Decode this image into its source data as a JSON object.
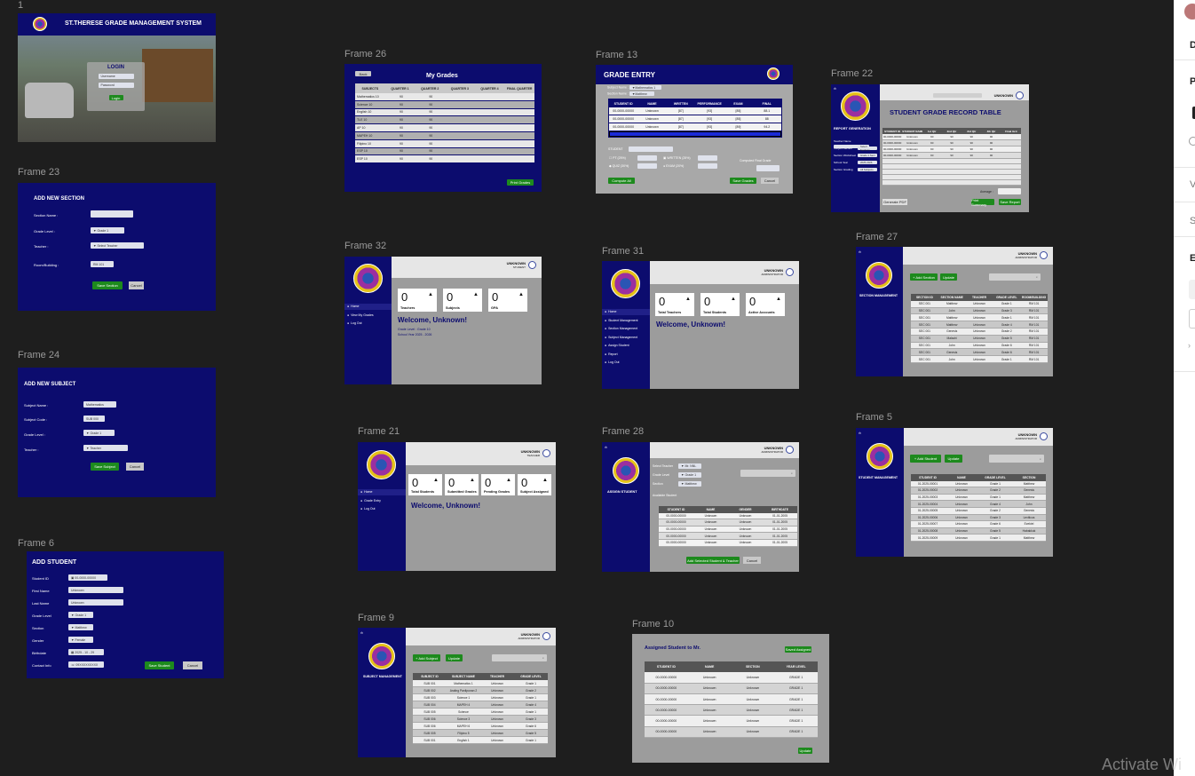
{
  "frames": {
    "f1": {
      "label": "1",
      "title": "ST.THERESE GRADE MANAGEMENT SYSTEM",
      "login": "LOGIN",
      "user_ph": "Username",
      "pass_ph": "Password",
      "login_btn": "Login"
    },
    "f23": {
      "label": "Frame 23",
      "title": "ADD NEW SECTION",
      "fields": [
        "Section Name :",
        "Grade Level :",
        "Teacher :",
        "Room/Building :"
      ],
      "grade": "Grade 1",
      "teacher": "Select Teacher",
      "room": "RM 101",
      "save": "Save Section",
      "cancel": "Cancel"
    },
    "f24": {
      "label": "Frame 24",
      "title": "ADD NEW SUBJECT",
      "fields": [
        "Subject Name :",
        "Subject Code :",
        "Grade Level :",
        "Teacher :"
      ],
      "name": "Mathematics",
      "code": "SUB 000",
      "grade": "Grade 1",
      "teacher": "Teacher",
      "save": "Save Subject",
      "cancel": "Cancel"
    },
    "f6": {
      "label": "Frame 6",
      "title": "ADD STUDENT",
      "fields": [
        "Student ID",
        "First Name",
        "Last Name",
        "Grade Level",
        "Section",
        "Gender",
        "Birthdate",
        "Contact Info"
      ],
      "values": [
        "00-0000-00000",
        "Unknown",
        "Unknown",
        "Grade 1",
        "Matthew",
        "Female",
        "2025 - 10 - 29",
        "09XXXXXXXXX"
      ],
      "save": "Save Student",
      "cancel": "Cancel"
    },
    "f26": {
      "label": "Frame 26",
      "title": "My Grades",
      "back": "Back",
      "headers": [
        "SUBJECTS",
        "QUARTER 1",
        "QUARTER 2",
        "QUARTER 3",
        "QUARTER 4",
        "FINAL QUARTER"
      ],
      "rows": [
        [
          "Mathematics 10",
          "90",
          "90"
        ],
        [
          "Science 10",
          "90",
          "90"
        ],
        [
          "English 10",
          "90",
          "90"
        ],
        [
          "TLE 10",
          "90",
          "90"
        ],
        [
          "AP 10",
          "90",
          "90"
        ],
        [
          "MAPEH 10",
          "90",
          "90"
        ],
        [
          "Filipino 10",
          "90",
          "90"
        ],
        [
          "ESP 10",
          "90",
          "90"
        ],
        [
          "ESP 10",
          "90",
          "90"
        ]
      ],
      "print": "Print Grades"
    },
    "f13": {
      "label": "Frame 13",
      "title": "GRADE ENTRY",
      "subject_lbl": "Subject Name :",
      "subject": "Mathematics 1",
      "section_lbl": "Section Name :",
      "section": "Matthew",
      "headers": [
        "STUDENT ID",
        "NAME",
        "WRITTEN",
        "PERFORMANCE",
        "EXAM",
        "FINAL"
      ],
      "rows": [
        [
          "00-0000-00000",
          "Unknown",
          "[87]",
          "[93]",
          "[85]",
          "88.1"
        ],
        [
          "00-0000-00000",
          "Unknown",
          "[87]",
          "[93]",
          "[85]",
          "88"
        ],
        [
          "00-0000-00000",
          "Unknown",
          "[87]",
          "[93]",
          "[89]",
          "94.2"
        ]
      ],
      "student": "STUDENT",
      "pt": "PT (25%)",
      "wwt": "WRITTEN (25%)",
      "quiz": "QUIZ (30%)",
      "exam": "EXAM (20%)",
      "computed": "Computed Final Grade",
      "compute_all": "Compute All",
      "save": "Save Grades",
      "cancel": "Cancel"
    },
    "f22": {
      "label": "Frame 22",
      "title": "STUDENT GRADE RECORD TABLE",
      "side": "REPORT GENERATION",
      "user": "UNKNOWN",
      "role": "Teacher",
      "fields": [
        "Teacher Name",
        "Subject/Section",
        "Section Worksheet",
        "School Year",
        "Section Grading"
      ],
      "field_vals": [
        "Select Sections",
        "Grade 1 Sect",
        "2025-2026",
        "All Subjects"
      ],
      "headers": [
        "STUDENT ID",
        "STUDENT NAME",
        "1st Qtr",
        "2nd Qtr",
        "3rd Qtr",
        "4th Qtr",
        "Final Grd"
      ],
      "rows": [
        [
          "00-0000-00000",
          "Unknown",
          "90",
          "90",
          "90",
          "90",
          ""
        ],
        [
          "00-0000-00000",
          "Unknown",
          "90",
          "90",
          "90",
          "90",
          ""
        ],
        [
          "00-0000-00000",
          "Unknown",
          "90",
          "90",
          "90",
          "90",
          ""
        ],
        [
          "00-0000-00000",
          "Unknown",
          "90",
          "90",
          "90",
          "90",
          ""
        ]
      ],
      "average": "Average :",
      "gen_pdf": "Generate PDF",
      "print": "Print Summary",
      "save": "Save Report"
    },
    "f32": {
      "label": "Frame 32",
      "user": "UNKNOWN",
      "role": "STUDENT",
      "cards": [
        {
          "n": "0",
          "l": "Teachers"
        },
        {
          "n": "0",
          "l": "Subjects"
        },
        {
          "n": "0",
          "l": "GPA"
        }
      ],
      "welcome": "Welcome, Unknown!",
      "grade": "Grade Level : Grade 10",
      "sy": "School Year 2025 - 2026",
      "nav": [
        "Home",
        "View My Grades",
        "Log Out"
      ]
    },
    "f31": {
      "label": "Frame 31",
      "user": "UNKNOWN",
      "role": "ADMINISTRATOR",
      "cards": [
        {
          "n": "0",
          "l": "Total Teachers"
        },
        {
          "n": "0",
          "l": "Total Students"
        },
        {
          "n": "0",
          "l": "Active Accounts"
        }
      ],
      "welcome": "Welcome, Unknown!",
      "nav": [
        "Home",
        "Student Management",
        "Section Management",
        "Subject Management",
        "Assign Student",
        "Report",
        "Log Out"
      ]
    },
    "f27": {
      "label": "Frame 27",
      "side": "SECTION MANAGEMENT",
      "user": "UNKNOWN",
      "role": "ADMINISTRATOR",
      "add": "+ Add Section",
      "update": "Update",
      "headers": [
        "SECTION ID",
        "SECTION NAME",
        "TEACHER",
        "GRADE LEVEL",
        "ROOM/BUILDING"
      ],
      "rows": [
        [
          "SEC 001",
          "Matthew",
          "Unknown",
          "Grade 1",
          "RM 101"
        ],
        [
          "SEC 001",
          "John",
          "Unknown",
          "Grade 3",
          "RM 101"
        ],
        [
          "SEC 001",
          "Matthew",
          "Unknown",
          "Grade 1",
          "RM 101"
        ],
        [
          "SEC 001",
          "Matthew",
          "Unknown",
          "Grade 4",
          "RM 101"
        ],
        [
          "SEC 001",
          "Genesis",
          "Unknown",
          "Grade 2",
          "RM 101"
        ],
        [
          "SEC 001",
          "Malachi",
          "Unknown",
          "Grade 5",
          "RM 101"
        ],
        [
          "SEC 001",
          "John",
          "Unknown",
          "Grade 6",
          "RM 101"
        ],
        [
          "SEC 001",
          "Genesis",
          "Unknown",
          "Grade 6",
          "RM 101"
        ],
        [
          "SEC 001",
          "John",
          "Unknown",
          "Grade 1",
          "RM 101"
        ]
      ]
    },
    "f21": {
      "label": "Frame 21",
      "user": "UNKNOWN",
      "role": "TEACHER",
      "cards": [
        {
          "n": "0",
          "l": "Total Students"
        },
        {
          "n": "0",
          "l": "Submitted Grades"
        },
        {
          "n": "0",
          "l": "Pending Grades"
        },
        {
          "n": "0",
          "l": "Subject Assigned"
        }
      ],
      "welcome": "Welcome, Unknown!",
      "nav": [
        "Home",
        "Grade Entry",
        "Log Out"
      ]
    },
    "f28": {
      "label": "Frame 28",
      "side": "ASSIGN STUDENT",
      "user": "UNKNOWN",
      "role": "ADMINISTRATOR",
      "fields": [
        "Select Teacher",
        "Grade Level",
        "Section"
      ],
      "vals": [
        "Mr. NNL",
        "Grade 1",
        "Matthew"
      ],
      "available": "Available Student",
      "headers": [
        "STUDENT ID",
        "NAME",
        "GENDER",
        "BIRTHDATE"
      ],
      "rows": [
        [
          "00-0000-00000",
          "Unknown",
          "Unknown",
          "01-01-2005"
        ],
        [
          "00-0000-00000",
          "Unknown",
          "Unknown",
          "01-01-2005"
        ],
        [
          "00-0000-00000",
          "Unknown",
          "Unknown",
          "01-01-2005"
        ],
        [
          "00-0000-00000",
          "Unknown",
          "Unknown",
          "01-01-2005"
        ],
        [
          "00-0000-00000",
          "Unknown",
          "Unknown",
          "01-01-2005"
        ]
      ],
      "add": "Add Selected Student & Teacher",
      "cancel": "Cancel"
    },
    "f5": {
      "label": "Frame 5",
      "side": "STUDENT MANAGEMENT",
      "user": "UNKNOWN",
      "role": "ADMINISTRATOR",
      "add": "+ Add Student",
      "update": "Update",
      "headers": [
        "STUDENT ID",
        "NAME",
        "GRADE LEVEL",
        "SECTION"
      ],
      "rows": [
        [
          "01-2025-00001",
          "Unknown",
          "Grade 1",
          "Matthew"
        ],
        [
          "01-2025-00002",
          "Unknown",
          "Grade 2",
          "Genesis"
        ],
        [
          "01-2025-00003",
          "Unknown",
          "Grade 1",
          "Matthew"
        ],
        [
          "01-2025-00004",
          "Unknown",
          "Grade 4",
          "John"
        ],
        [
          "01-2025-00005",
          "Unknown",
          "Grade 2",
          "Genesis"
        ],
        [
          "01-2025-00006",
          "Unknown",
          "Grade 3",
          "Leviticus"
        ],
        [
          "01-2025-00007",
          "Unknown",
          "Grade 6",
          "Ezekiel"
        ],
        [
          "01-2025-00008",
          "Unknown",
          "Grade 5",
          "Habakkuk"
        ],
        [
          "01-2025-00009",
          "Unknown",
          "Grade 1",
          "Matthew"
        ]
      ]
    },
    "f9": {
      "label": "Frame 9",
      "side": "SUBJECT MANAGEMENT",
      "user": "UNKNOWN",
      "role": "ADMINISTRATOR",
      "add": "+ Add Subject",
      "update": "Update",
      "headers": [
        "SUBJECT ID",
        "SUBJECT NAME",
        "TEACHER",
        "GRADE LEVEL"
      ],
      "rows": [
        [
          "SUB 001",
          "Mathematics 1",
          "Unknown",
          "Grade 1"
        ],
        [
          "SUB 002",
          "Araling Panlipunan 2",
          "Unknown",
          "Grade 2"
        ],
        [
          "SUB 003",
          "Science 1",
          "Unknown",
          "Grade 1"
        ],
        [
          "SUB 004",
          "MAPEH 4",
          "Unknown",
          "Grade 4"
        ],
        [
          "SUB 005",
          "Science",
          "Unknown",
          "Grade 1"
        ],
        [
          "SUB 006",
          "Science 3",
          "Unknown",
          "Grade 3"
        ],
        [
          "SUB 006",
          "MAPEH 6",
          "Unknown",
          "Grade 6"
        ],
        [
          "SUB 005",
          "Filipino 5",
          "Unknown",
          "Grade 5"
        ],
        [
          "SUB 001",
          "English 1",
          "Unknown",
          "Grade 1"
        ]
      ]
    },
    "f10": {
      "label": "Frame 10",
      "title": "Assigned Student to Mr.",
      "saved": "Saved Assigned",
      "headers": [
        "STUDENT ID",
        "NAME",
        "SECTION",
        "YEAR LEVEL"
      ],
      "rows": [
        [
          "00-0000-00000",
          "Unknown",
          "Unknown",
          "GRADE 1"
        ],
        [
          "00-0000-00000",
          "Unknown",
          "Unknown",
          "GRADE 1"
        ],
        [
          "00-0000-00000",
          "Unknown",
          "Unknown",
          "GRADE 1"
        ],
        [
          "00-0000-00000",
          "Unknown",
          "Unknown",
          "GRADE 1"
        ],
        [
          "00-0000-00000",
          "Unknown",
          "Unknown",
          "GRADE 1"
        ],
        [
          "00-0000-00000",
          "Unknown",
          "Unknown",
          "GRADE 1"
        ]
      ],
      "update": "Update"
    }
  },
  "panel": {
    "items": [
      "D",
      "P",
      "V",
      "S",
      "E"
    ]
  },
  "watermark": "Activate Wi"
}
